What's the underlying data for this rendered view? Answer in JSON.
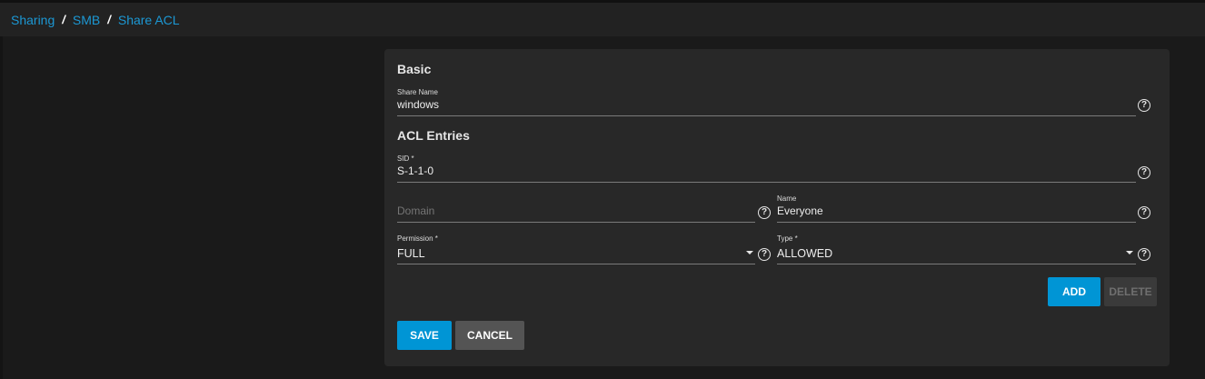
{
  "breadcrumb": {
    "items": [
      "Sharing",
      "SMB",
      "Share ACL"
    ],
    "separator": "/"
  },
  "form": {
    "basic_title": "Basic",
    "share_name": {
      "label": "Share Name",
      "value": "windows"
    },
    "acl_title": "ACL Entries",
    "sid": {
      "label": "SID *",
      "value": "S-1-1-0"
    },
    "domain": {
      "placeholder": "Domain"
    },
    "name": {
      "label": "Name",
      "value": "Everyone"
    },
    "permission": {
      "label": "Permission *",
      "value": "FULL"
    },
    "type": {
      "label": "Type *",
      "value": "ALLOWED"
    },
    "help_glyph": "?",
    "add_label": "ADD",
    "delete_label": "DELETE",
    "save_label": "SAVE",
    "cancel_label": "CANCEL"
  },
  "icons": {
    "help": "help-circle-icon",
    "dropdown": "caret-down-icon"
  },
  "colors": {
    "accent": "#0095d5",
    "link": "#1c98d4",
    "background": "#1a1a1a",
    "card": "#282828"
  }
}
